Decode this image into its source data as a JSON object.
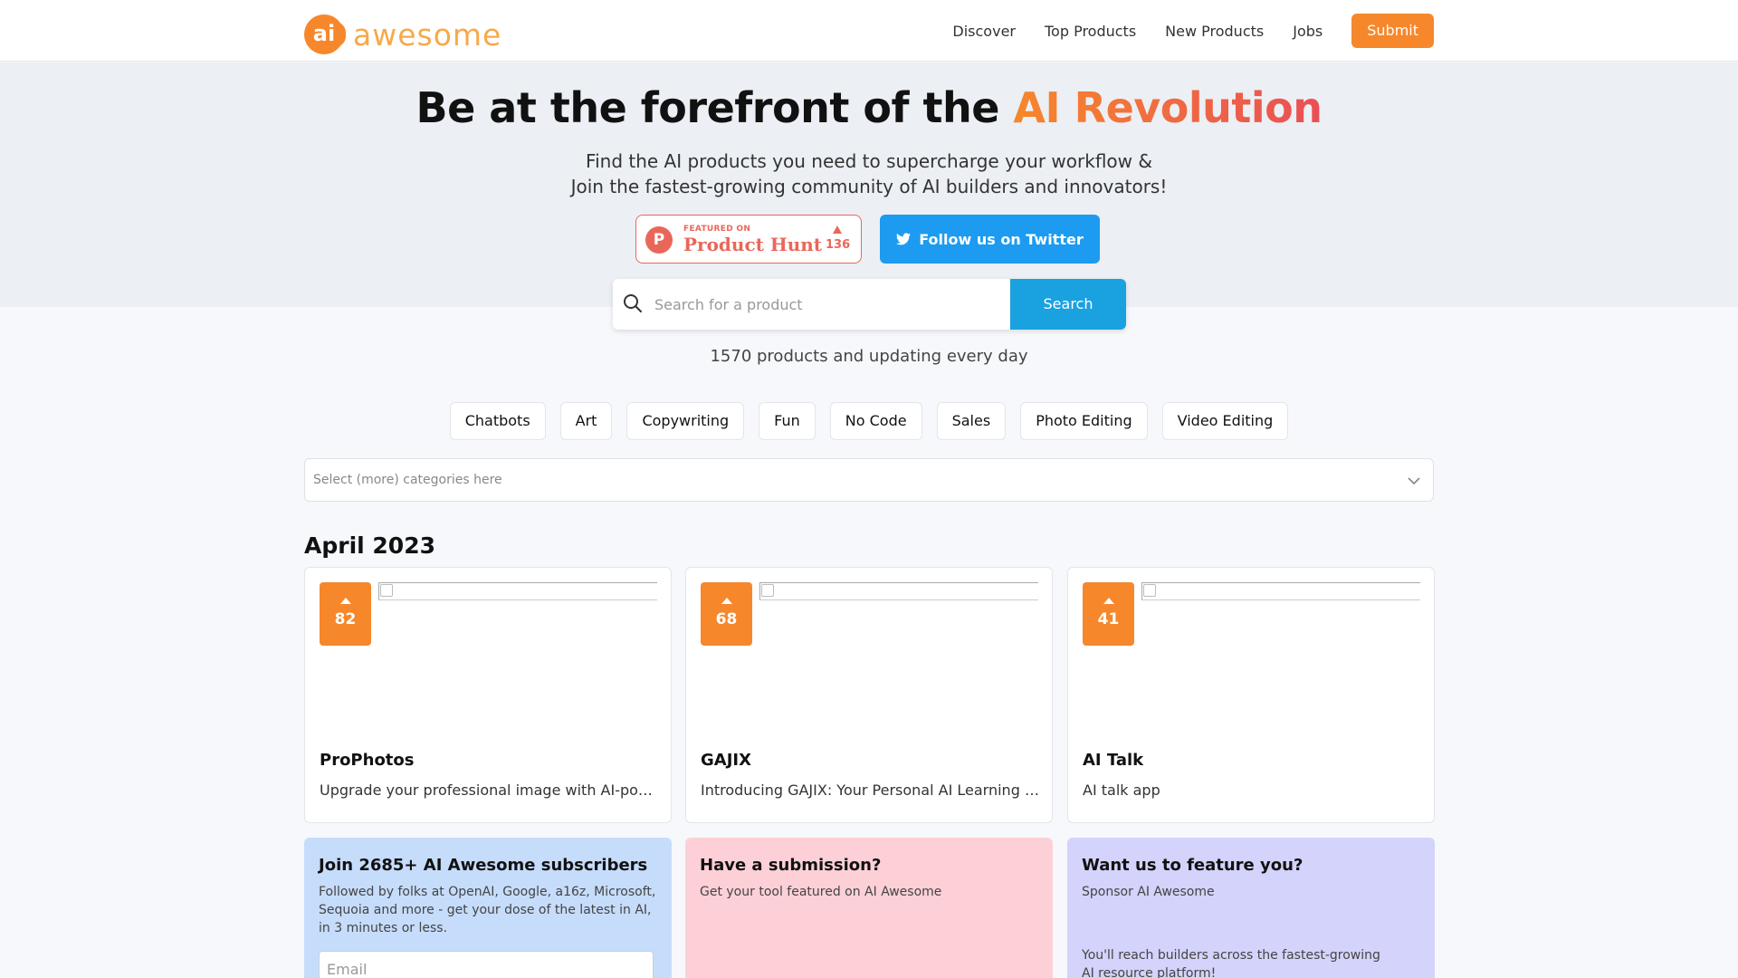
{
  "nav": {
    "logo_mark": "ai",
    "logo_text": "awesome",
    "links": [
      "Discover",
      "Top Products",
      "New Products",
      "Jobs"
    ],
    "submit_label": "Submit"
  },
  "hero": {
    "title_prefix": "Be at the forefront of the ",
    "title_highlight": "AI Revolution",
    "subtitle_line1": "Find the AI products you need to supercharge your workflow &",
    "subtitle_line2": "Join the fastest-growing community of AI builders and innovators!",
    "product_hunt": {
      "logo": "P",
      "featured_on": "FEATURED ON",
      "name": "Product Hunt",
      "count": "136"
    },
    "twitter_label": "Follow us on Twitter"
  },
  "search": {
    "placeholder": "Search for a product",
    "button_label": "Search",
    "count_text": "1570 products and updating every day"
  },
  "categories": {
    "chips": [
      "Chatbots",
      "Art",
      "Copywriting",
      "Fun",
      "No Code",
      "Sales",
      "Photo Editing",
      "Video Editing"
    ],
    "select_placeholder": "Select (more) categories here"
  },
  "section": {
    "month": "April 2023"
  },
  "products": [
    {
      "votes": "82",
      "name": "ProPhotos",
      "description": "Upgrade your professional image with AI-powered headshots"
    },
    {
      "votes": "68",
      "name": "GAJIX",
      "description": "Introducing GAJIX: Your Personal AI Learning Assistant"
    },
    {
      "votes": "41",
      "name": "AI Talk",
      "description": "AI talk app"
    }
  ],
  "promos": [
    {
      "title": "Join 2685+ AI Awesome subscribers",
      "text": "Followed by folks at OpenAI, Google, a16z, Microsoft, Sequoia and more - get your dose of the latest in AI, in 3 minutes or less.",
      "email_placeholder": "Email",
      "color": "#c6dcfb"
    },
    {
      "title": "Have a submission?",
      "text": "Get your tool featured on AI Awesome",
      "color": "#fdd0d8"
    },
    {
      "title": "Want us to feature you?",
      "text": "Sponsor AI Awesome",
      "footer": "You'll reach builders across the fastest-growing AI resource platform!",
      "color": "#d3d3fb"
    }
  ],
  "colors": {
    "accent_orange": "#f7872b",
    "twitter_blue": "#1d9bf0",
    "search_blue": "#1aa1e0"
  }
}
